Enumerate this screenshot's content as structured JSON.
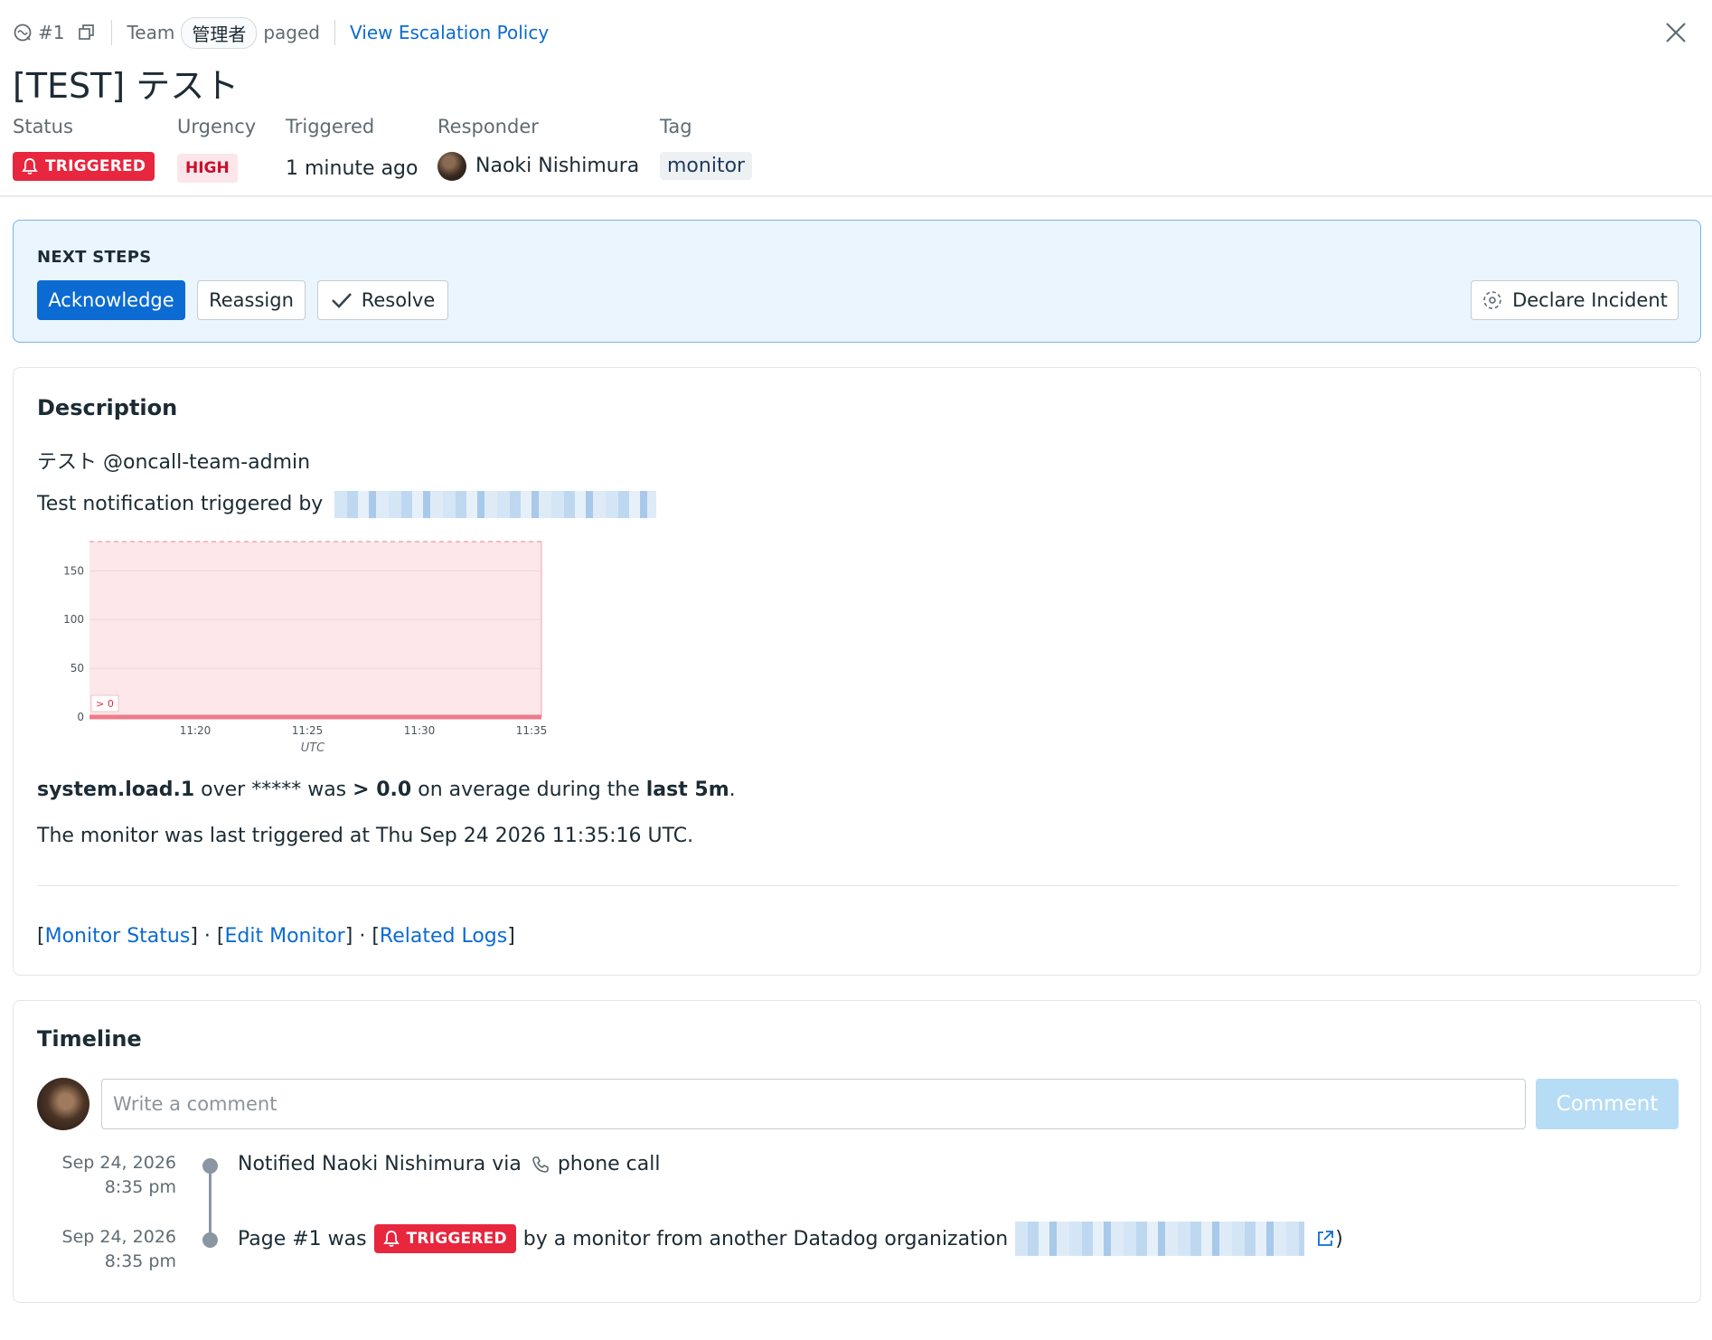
{
  "header": {
    "page_id": "#1",
    "team_label": "Team",
    "team_name": "管理者",
    "paged_label": "paged",
    "escalation_link": "View Escalation Policy",
    "title": "[TEST] テスト"
  },
  "meta": {
    "status_label": "Status",
    "status_value": "TRIGGERED",
    "urgency_label": "Urgency",
    "urgency_value": "HIGH",
    "triggered_label": "Triggered",
    "triggered_value": "1 minute ago",
    "responder_label": "Responder",
    "responder_name": "Naoki Nishimura",
    "tag_label": "Tag",
    "tag_value": "monitor"
  },
  "next_steps": {
    "label": "NEXT STEPS",
    "acknowledge": "Acknowledge",
    "reassign": "Reassign",
    "resolve": "Resolve",
    "declare_incident": "Declare Incident"
  },
  "description": {
    "title": "Description",
    "line1": "テスト @oncall-team-admin",
    "line2_prefix": "Test notification triggered by",
    "metric": "system.load.1",
    "over": " over ",
    "mask": "*****",
    "was": " was ",
    "threshold": "> 0.0",
    "on_avg": " on average during the ",
    "window": "last 5m",
    "period": ".",
    "last_triggered": "The monitor was last triggered at Thu Sep 24 2026 11:35:16 UTC.",
    "links": {
      "monitor_status": "Monitor Status",
      "edit_monitor": "Edit Monitor",
      "related_logs": "Related Logs",
      "bracket_open": "[",
      "bracket_close": "]",
      "dot": " · "
    }
  },
  "chart_data": {
    "type": "area",
    "x": [
      "11:20",
      "11:25",
      "11:30",
      "11:35"
    ],
    "x_axis_label": "UTC",
    "y_ticks": [
      0,
      50,
      100,
      150
    ],
    "ylim": [
      0,
      180
    ],
    "threshold_label": "> 0",
    "threshold": 0,
    "colors": {
      "threshold_area": "#fde7ea",
      "series": "#f07a8a"
    }
  },
  "timeline": {
    "title": "Timeline",
    "comment_placeholder": "Write a comment",
    "comment_button": "Comment",
    "events": [
      {
        "date": "Sep 24, 2026",
        "time": "8:35 pm",
        "text": "Notified Naoki Nishimura via",
        "channel": "phone call"
      },
      {
        "date": "Sep 24, 2026",
        "time": "8:35 pm",
        "prefix": "Page #1 was",
        "badge": "TRIGGERED",
        "suffix": "by a monitor from another Datadog organization",
        "close": ")"
      }
    ]
  },
  "colors": {
    "primary": "#0b6bd3",
    "triggered": "#e8263e",
    "high_bg": "#fde6e9",
    "next_bg": "#eaf5fd"
  }
}
